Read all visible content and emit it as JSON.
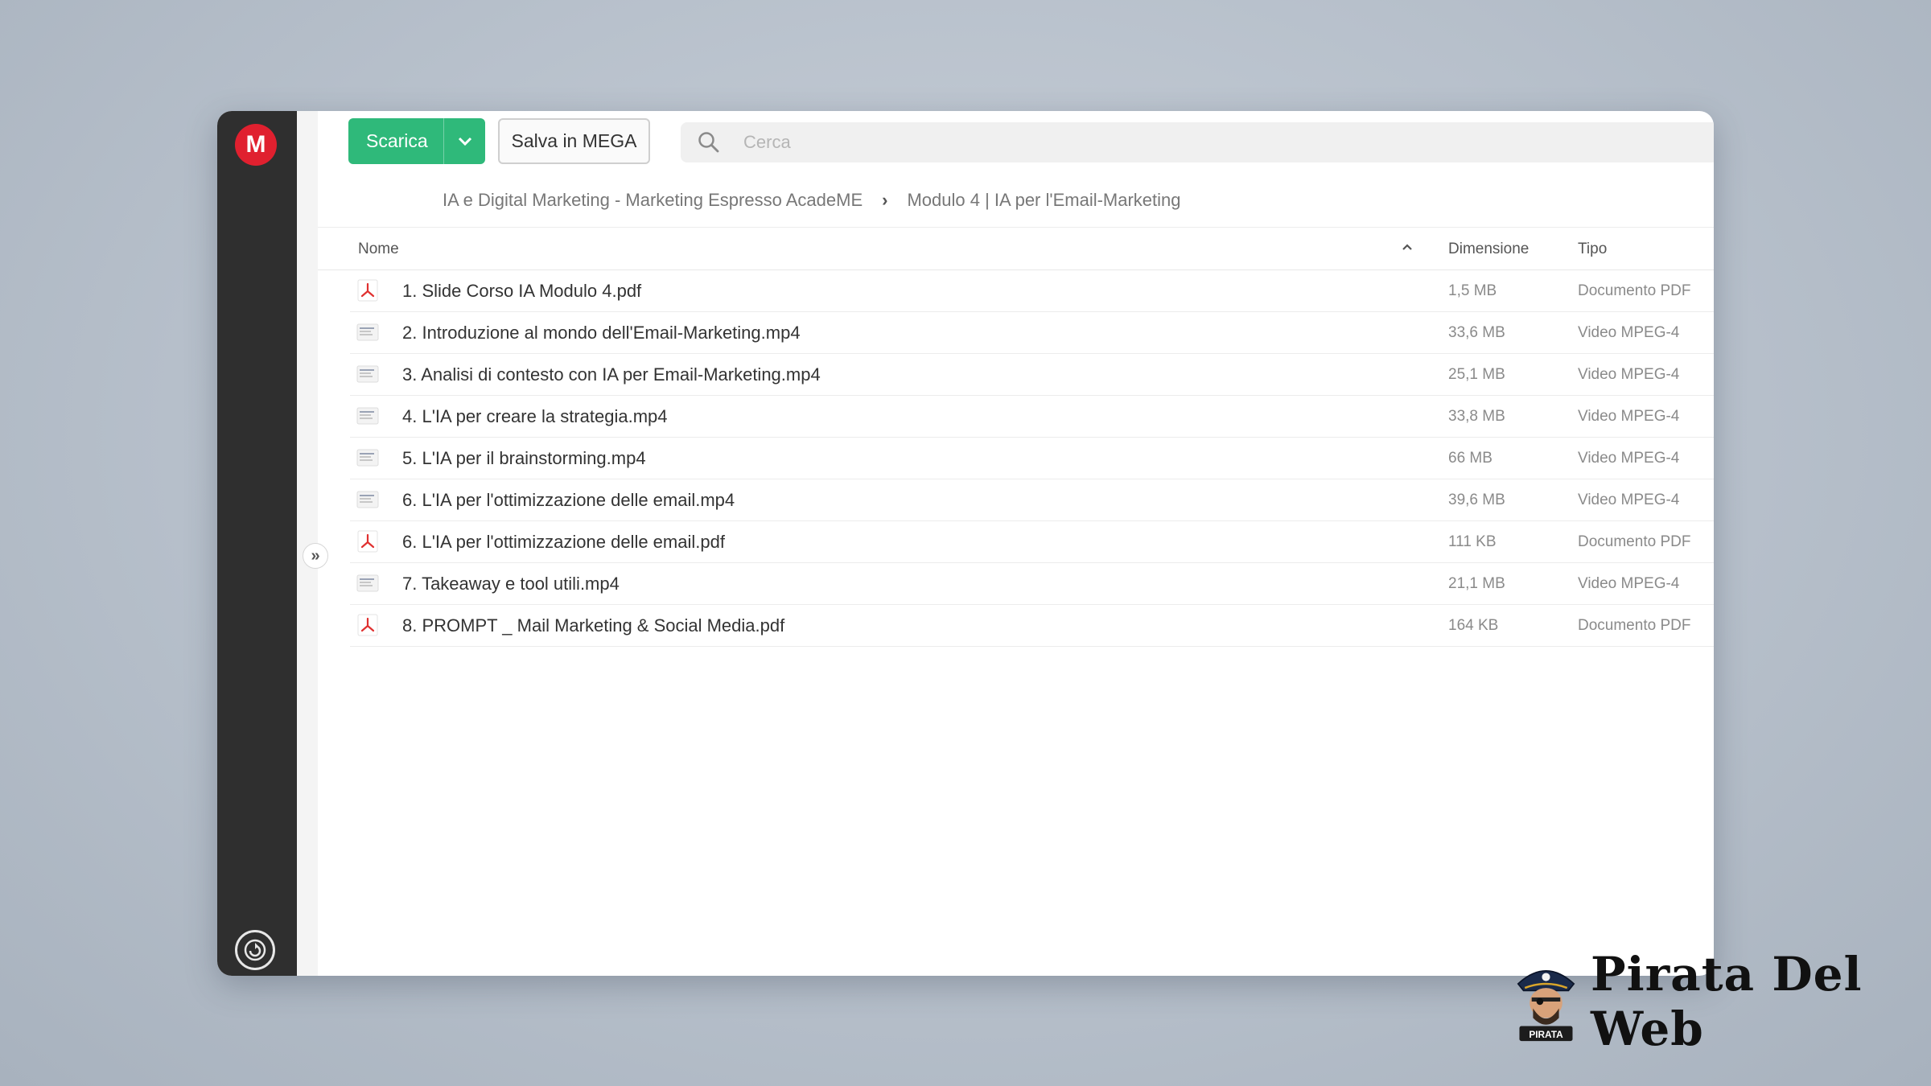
{
  "toolbar": {
    "download_label": "Scarica",
    "save_label": "Salva in MEGA",
    "search_placeholder": "Cerca"
  },
  "breadcrumb": {
    "parent": "IA e Digital Marketing - Marketing Espresso AcadeME",
    "current": "Modulo 4 | IA per l'Email-Marketing"
  },
  "table": {
    "headers": {
      "name": "Nome",
      "size": "Dimensione",
      "type": "Tipo"
    },
    "rows": [
      {
        "icon": "pdf-icon",
        "name": "1. Slide Corso IA Modulo 4.pdf",
        "size": "1,5 MB",
        "type": "Documento PDF"
      },
      {
        "icon": "video-thumbnail-icon",
        "name": "2. Introduzione al mondo dell'Email-Marketing.mp4",
        "size": "33,6 MB",
        "type": "Video MPEG-4"
      },
      {
        "icon": "video-thumbnail-icon",
        "name": "3. Analisi di contesto con IA per Email-Marketing.mp4",
        "size": "25,1 MB",
        "type": "Video MPEG-4"
      },
      {
        "icon": "video-thumbnail-icon",
        "name": "4. L'IA per creare la strategia.mp4",
        "size": "33,8 MB",
        "type": "Video MPEG-4"
      },
      {
        "icon": "video-thumbnail-icon",
        "name": "5. L'IA per il brainstorming.mp4",
        "size": "66 MB",
        "type": "Video MPEG-4"
      },
      {
        "icon": "video-thumbnail-icon",
        "name": "6. L'IA per l'ottimizzazione delle email.mp4",
        "size": "39,6 MB",
        "type": "Video MPEG-4"
      },
      {
        "icon": "pdf-icon",
        "name": "6. L'IA per l'ottimizzazione delle email.pdf",
        "size": "111 KB",
        "type": "Documento PDF"
      },
      {
        "icon": "video-thumbnail-icon",
        "name": "7. Takeaway e tool utili.mp4",
        "size": "21,1 MB",
        "type": "Video MPEG-4"
      },
      {
        "icon": "pdf-icon",
        "name": "8. PROMPT _ Mail Marketing & Social Media.pdf",
        "size": "164 KB",
        "type": "Documento PDF"
      }
    ]
  },
  "brand": {
    "name": "Pirata Del Web",
    "mascot_label": "PIRATA"
  },
  "colors": {
    "accent_green": "#2fb97a",
    "mega_red": "#e0202f",
    "rail_dark": "#2f2f2f"
  }
}
